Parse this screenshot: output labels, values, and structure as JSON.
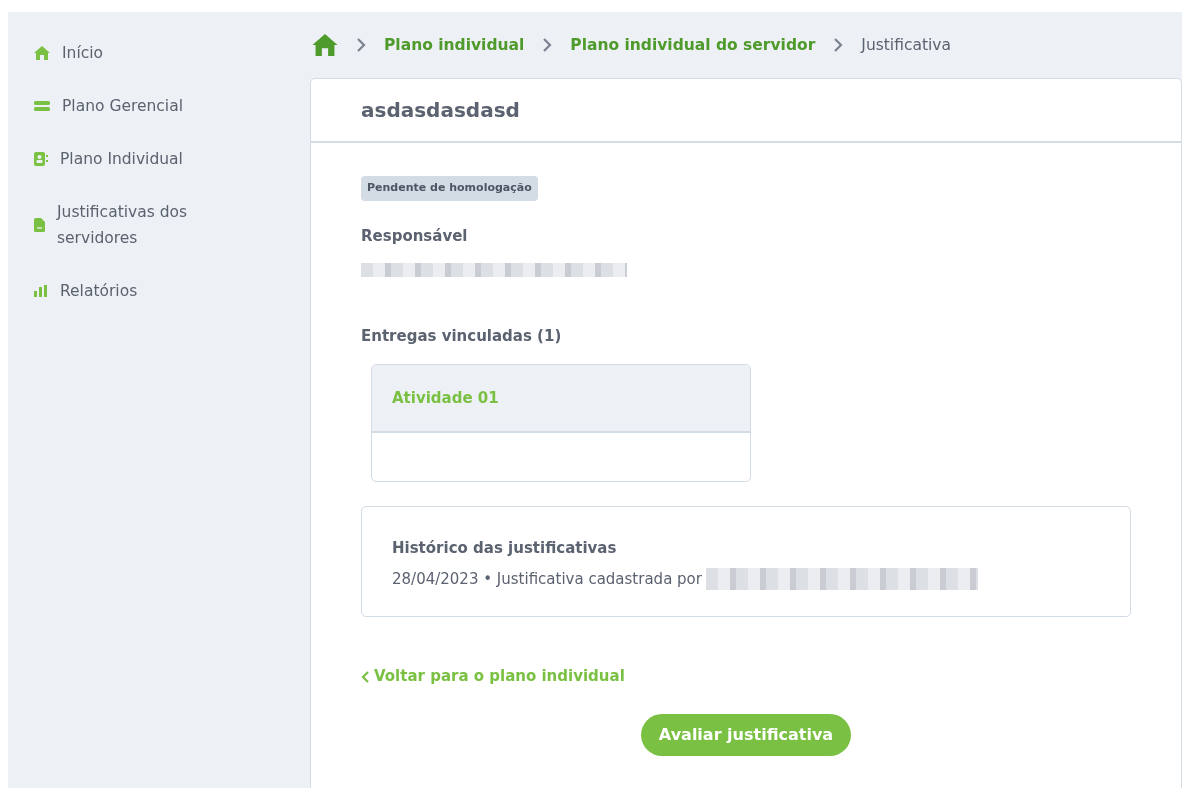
{
  "sidebar": {
    "items": [
      {
        "label": "Início"
      },
      {
        "label": "Plano Gerencial"
      },
      {
        "label": "Plano Individual"
      },
      {
        "label": "Justificativas dos servidores"
      },
      {
        "label": "Relatórios"
      }
    ]
  },
  "breadcrumb": [
    {
      "label": "Plano individual",
      "current": false
    },
    {
      "label": "Plano individual do servidor",
      "current": false
    },
    {
      "label": "Justificativa",
      "current": true
    }
  ],
  "card": {
    "title": "asdasdasdasd",
    "status": "Pendente de homologação",
    "responsible_label": "Responsável",
    "deliveries_label": "Entregas vinculadas (1)",
    "deliveries": [
      {
        "title": "Atividade 01"
      }
    ],
    "history": {
      "title": "Histórico das justificativas",
      "entries": [
        {
          "text": "28/04/2023 • Justificativa cadastrada por"
        }
      ]
    },
    "back_link": "Voltar para o plano individual",
    "action_button": "Avaliar justificativa"
  }
}
